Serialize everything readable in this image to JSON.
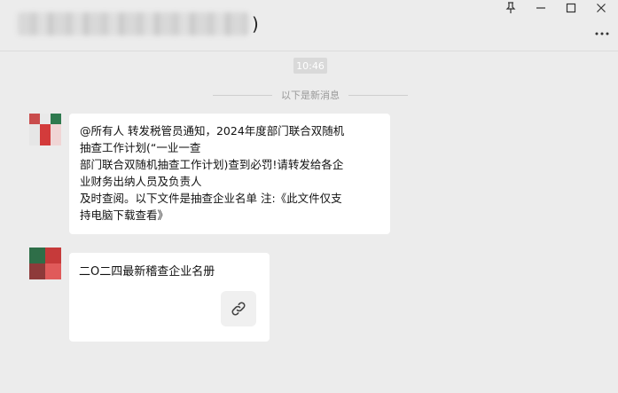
{
  "header": {
    "title_suffix": ")"
  },
  "window_controls": [
    "pin-icon",
    "minimize-icon",
    "maximize-icon",
    "close-icon"
  ],
  "chat": {
    "timestamp": "10:46",
    "new_messages_divider": "以下是新消息",
    "messages": [
      {
        "type": "text",
        "lines": [
          "@所有人 转发税管员通知，2024年度部门联合双随机",
          "抽查工作计划(“一业一查",
          "部门联合双随机抽查工作计划)查到必罚!请转发给各企",
          "业财务出纳人员及负责人",
          "及时查阅。以下文件是抽查企业名单 注:《此文件仅支",
          "持电脑下载查看》"
        ]
      },
      {
        "type": "link_card",
        "title": "二O二四最新稽查企业名册",
        "icon": "link-icon"
      }
    ]
  },
  "colors": {
    "background": "#ececec",
    "bubble": "#ffffff",
    "timestamp_bg": "#d9d9d9"
  }
}
